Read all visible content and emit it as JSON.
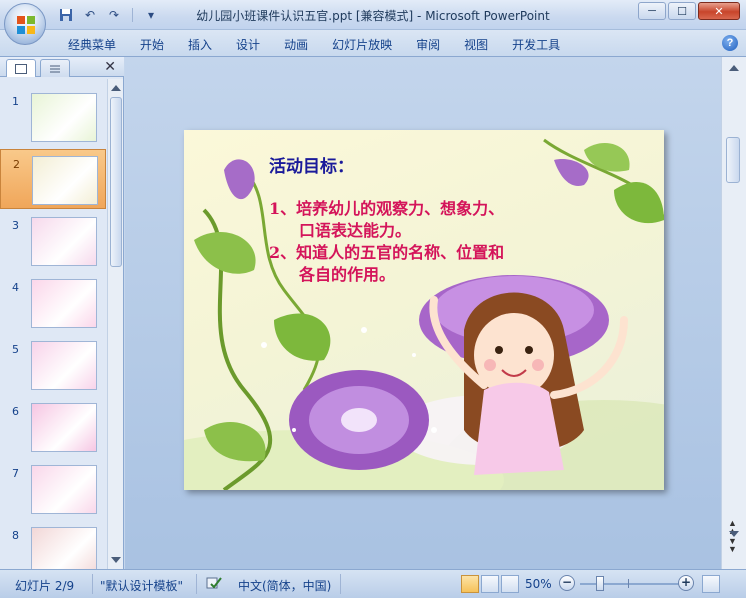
{
  "window": {
    "title": "幼儿园小班课件认识五官.ppt [兼容模式] - Microsoft PowerPoint",
    "controls": {
      "minimize": "─",
      "maximize": "☐",
      "close": "✕"
    }
  },
  "quick_access": {
    "save_icon": "save-icon",
    "undo_icon": "undo-icon",
    "redo_icon": "redo-icon",
    "customize_icon": "customize-icon"
  },
  "ribbon": {
    "tabs": [
      "经典菜单",
      "开始",
      "插入",
      "设计",
      "动画",
      "幻灯片放映",
      "审阅",
      "视图",
      "开发工具"
    ],
    "help": "?"
  },
  "left_panel": {
    "close": "✕",
    "slides": [
      {
        "num": "1",
        "theme": "#e8f4d6"
      },
      {
        "num": "2",
        "theme": "#f3eed4"
      },
      {
        "num": "3",
        "theme": "#f6d9ec"
      },
      {
        "num": "4",
        "theme": "#fbd6ea"
      },
      {
        "num": "5",
        "theme": "#f8d3ea"
      },
      {
        "num": "6",
        "theme": "#f6c6e3"
      },
      {
        "num": "7",
        "theme": "#f9d7ea"
      },
      {
        "num": "8",
        "theme": "#f2d7d7"
      }
    ],
    "active_index": 1
  },
  "slide": {
    "title": "活动目标：",
    "items": [
      {
        "line1": "1、培养幼儿的观察力、想象力、",
        "line2": "口语表达能力。"
      },
      {
        "line1": "2、知道人的五官的名称、位置和",
        "line2": "各自的作用。"
      }
    ],
    "title_color": "#1a1a9a",
    "body_color": "#d4145a"
  },
  "statusbar": {
    "slide_info": "幻灯片 2/9",
    "theme": "\"默认设计模板\"",
    "language": "中文(简体，中国)",
    "zoom": "50%",
    "zoom_minus": "−",
    "zoom_plus": "+"
  }
}
